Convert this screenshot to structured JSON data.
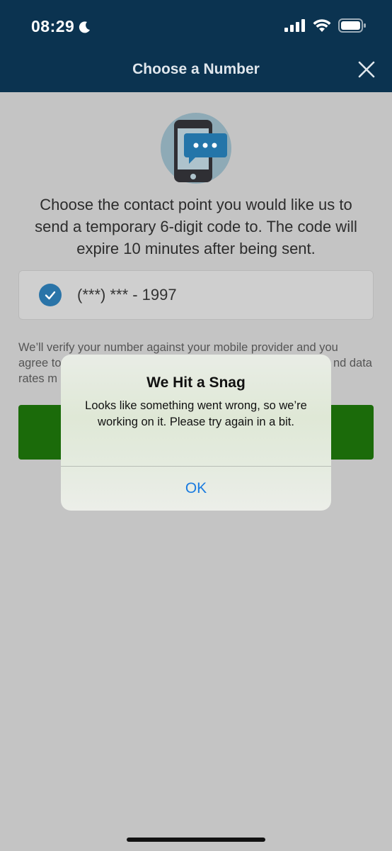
{
  "status_bar": {
    "time": "08:29",
    "icons": [
      "moon-icon",
      "cellular-signal-icon",
      "wifi-icon",
      "battery-icon"
    ]
  },
  "header": {
    "title": "Choose a Number",
    "close_icon": "close-icon"
  },
  "main": {
    "illustration": "phone-chat-icon",
    "instructions": "Choose the contact point you would like us to send a temporary 6-digit code to. The code will expire 10 minutes after being sent.",
    "contact_option": {
      "number": "(***) *** - 1997",
      "selected": true
    },
    "disclaimer_visible": {
      "line1": "We’ll verify your number against your mobile provider and you",
      "line2_start": "agree to",
      "line2_end": "nd data",
      "line3_start": "rates m"
    }
  },
  "alert": {
    "title": "We Hit a Snag",
    "message": "Looks like something went wrong, so we’re working on it. Please try again in a bit.",
    "ok_label": "OK"
  },
  "colors": {
    "header_bg": "#0b3350",
    "overlay_bg": "#c4c4c4",
    "button_green": "#1b6b0a",
    "check_blue": "#2a74a8",
    "alert_link": "#1a7be0"
  }
}
